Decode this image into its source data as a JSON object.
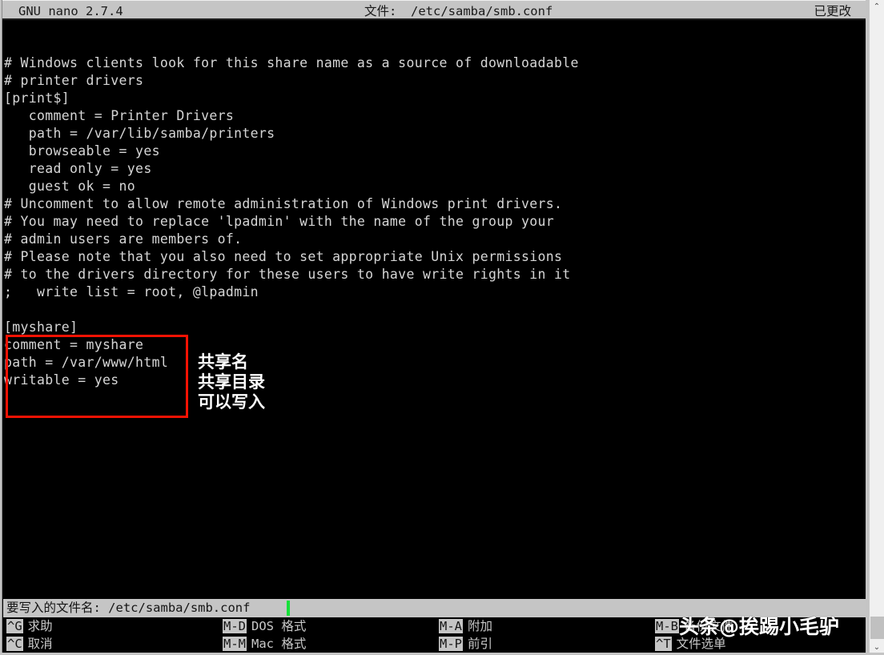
{
  "window": {
    "titlebar": {
      "app_version": "GNU nano 2.7.4",
      "file_label": "文件:",
      "file_path": "/etc/samba/smb.conf",
      "modified_flag": "已更改"
    }
  },
  "editor": {
    "lines": [
      "# Windows clients look for this share name as a source of downloadable",
      "# printer drivers",
      "[print$]",
      "   comment = Printer Drivers",
      "   path = /var/lib/samba/printers",
      "   browseable = yes",
      "   read only = yes",
      "   guest ok = no",
      "# Uncomment to allow remote administration of Windows print drivers.",
      "# You may need to replace 'lpadmin' with the name of the group your",
      "# admin users are members of.",
      "# Please note that you also need to set appropriate Unix permissions",
      "# to the drivers directory for these users to have write rights in it",
      ";   write list = root, @lpadmin",
      "",
      "[myshare]",
      "comment = myshare",
      "path = /var/www/html",
      "writable = yes"
    ]
  },
  "highlight": {
    "box_color": "#f61203",
    "annotations": [
      "共享名",
      "共享目录",
      "可以写入"
    ]
  },
  "prompt": {
    "label": "要写入的文件名:",
    "value": "/etc/samba/smb.conf"
  },
  "shortcuts": {
    "row1": [
      {
        "key": "^G",
        "desc": "求助"
      },
      {
        "key": "M-D",
        "desc": "DOS 格式"
      },
      {
        "key": "M-A",
        "desc": "附加"
      },
      {
        "key": "M-B",
        "desc": "备份文件"
      }
    ],
    "row2": [
      {
        "key": "^C",
        "desc": "取消"
      },
      {
        "key": "M-M",
        "desc": "Mac 格式"
      },
      {
        "key": "M-P",
        "desc": "前引"
      },
      {
        "key": "^T",
        "desc": "文件选单"
      }
    ]
  },
  "watermark": {
    "text": "头条@挨踢小毛驴"
  },
  "scrollbar": {
    "up_arrow": "⌃",
    "down_arrow": "⌄"
  }
}
